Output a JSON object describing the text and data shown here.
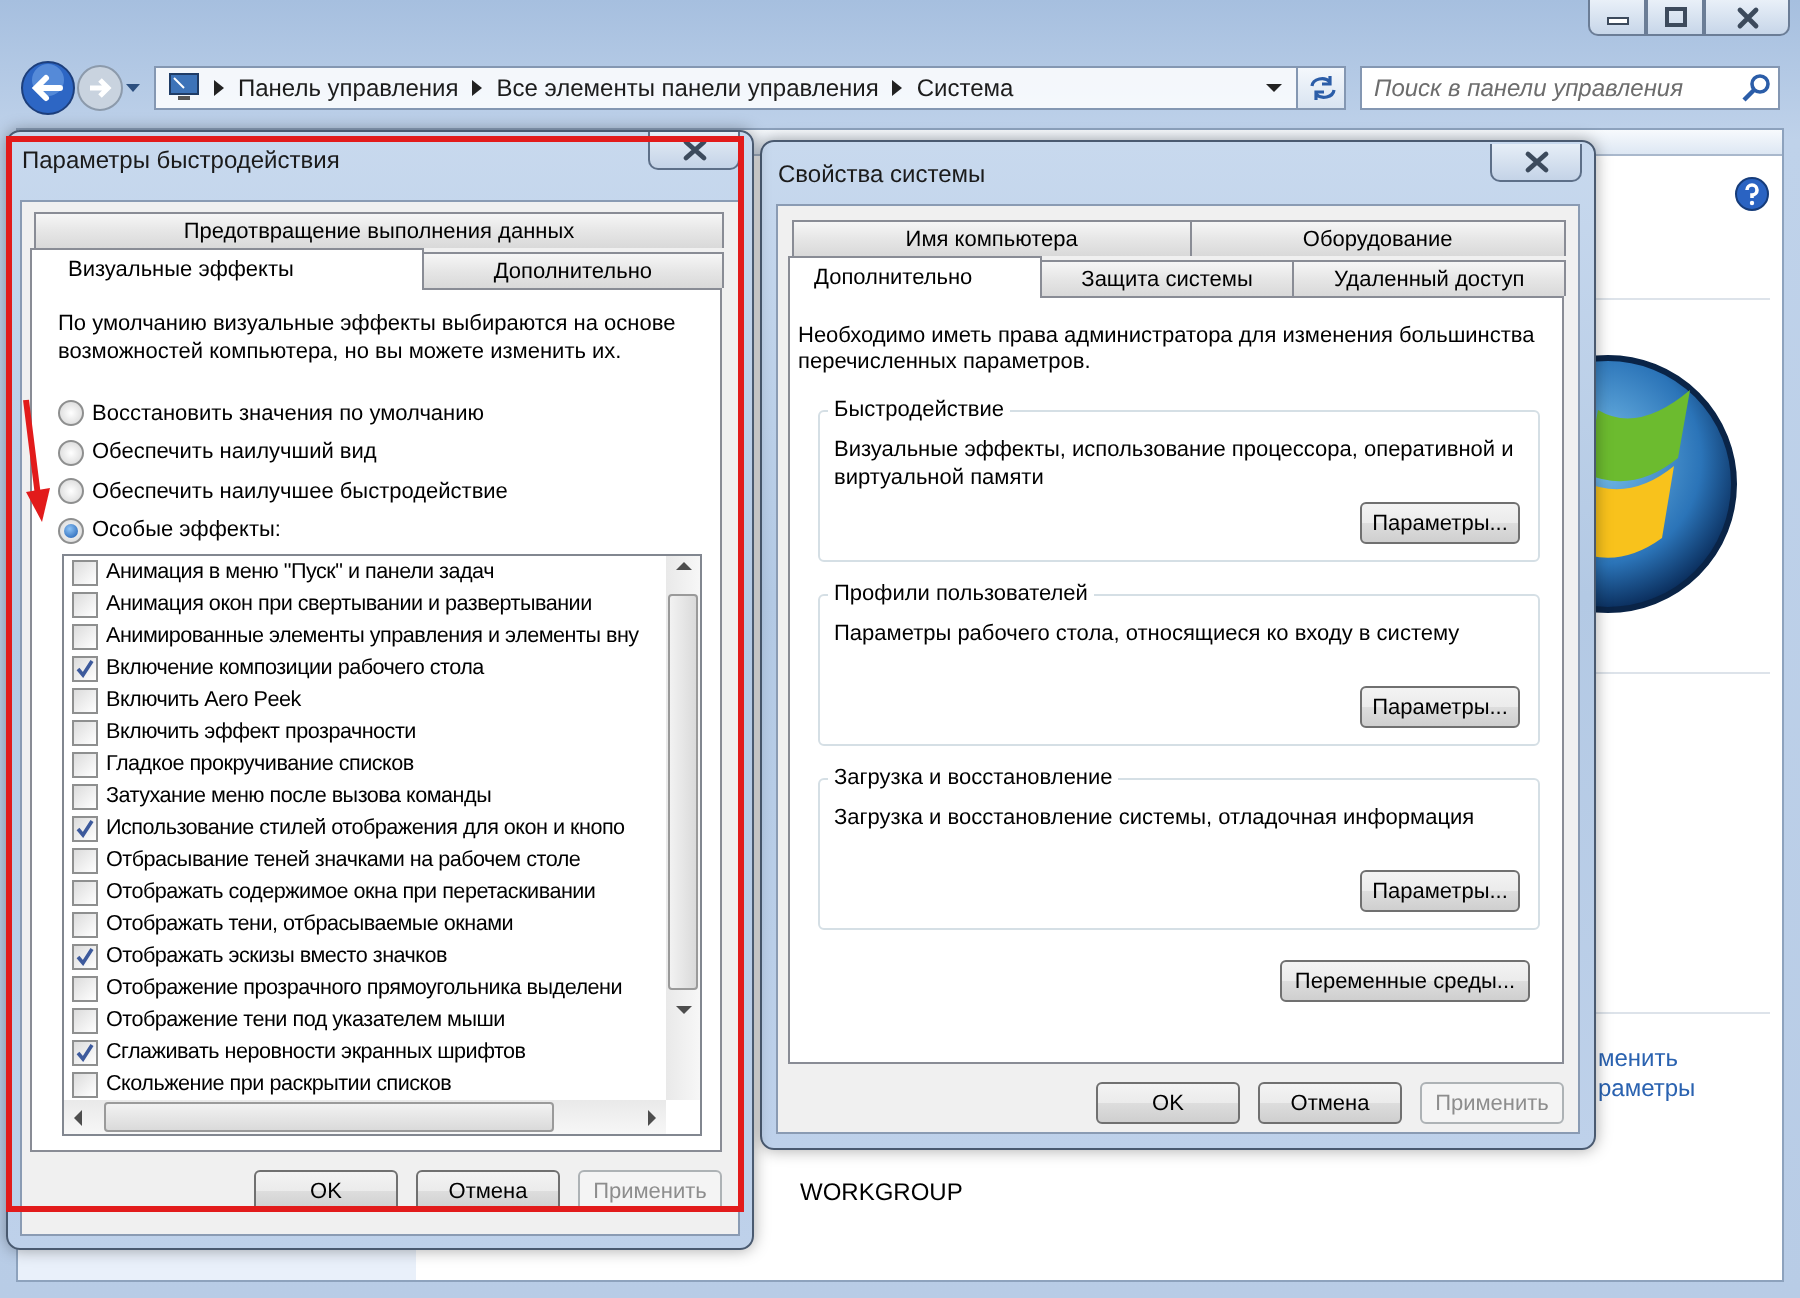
{
  "window": {
    "breadcrumb": [
      "Панель управления",
      "Все элементы панели управления",
      "Система"
    ],
    "search": {
      "placeholder": "Поиск в панели управления"
    },
    "side_links": [
      "менить",
      "раметры"
    ],
    "workgroup": "WORKGROUP"
  },
  "performance_dialog": {
    "title": "Параметры быстродействия",
    "tab_rows": [
      [
        {
          "label": "Предотвращение выполнения данных",
          "selected": false
        }
      ],
      [
        {
          "label": "Визуальные эффекты",
          "selected": true
        },
        {
          "label": "Дополнительно",
          "selected": false
        }
      ]
    ],
    "description": "По умолчанию визуальные эффекты выбираются на основе возможностей компьютера, но вы можете изменить их.",
    "options": [
      {
        "label": "Восстановить значения по умолчанию",
        "selected": false
      },
      {
        "label": "Обеспечить наилучший вид",
        "selected": false
      },
      {
        "label": "Обеспечить наилучшее быстродействие",
        "selected": false
      },
      {
        "label": "Особые эффекты:",
        "selected": true
      }
    ],
    "effects": [
      {
        "label": "Анимация в меню \"Пуск\" и панели задач",
        "checked": false
      },
      {
        "label": "Анимация окон при свертывании и развертывании",
        "checked": false
      },
      {
        "label": "Анимированные элементы управления и элементы вну",
        "checked": false
      },
      {
        "label": "Включение композиции рабочего стола",
        "checked": true
      },
      {
        "label": "Включить Aero Peek",
        "checked": false
      },
      {
        "label": "Включить эффект прозрачности",
        "checked": false
      },
      {
        "label": "Гладкое прокручивание списков",
        "checked": false
      },
      {
        "label": "Затухание меню после вызова команды",
        "checked": false
      },
      {
        "label": "Использование стилей отображения для окон и кнопо",
        "checked": true
      },
      {
        "label": "Отбрасывание теней значками на рабочем столе",
        "checked": false
      },
      {
        "label": "Отображать содержимое окна при перетаскивании",
        "checked": false
      },
      {
        "label": "Отображать тени, отбрасываемые окнами",
        "checked": false
      },
      {
        "label": "Отображать эскизы вместо значков",
        "checked": true
      },
      {
        "label": "Отображение прозрачного прямоугольника выделени",
        "checked": false
      },
      {
        "label": "Отображение тени под указателем мыши",
        "checked": false
      },
      {
        "label": "Сглаживать неровности экранных шрифтов",
        "checked": true
      },
      {
        "label": "Скольжение при раскрытии списков",
        "checked": false
      }
    ],
    "buttons": [
      {
        "label": "OK",
        "disabled": false
      },
      {
        "label": "Отмена",
        "disabled": false
      },
      {
        "label": "Применить",
        "disabled": true
      }
    ]
  },
  "system_dialog": {
    "title": "Свойства системы",
    "tab_rows": [
      [
        {
          "label": "Имя компьютера",
          "selected": false
        },
        {
          "label": "Оборудование",
          "selected": false
        }
      ],
      [
        {
          "label": "Дополнительно",
          "selected": true
        },
        {
          "label": "Защита системы",
          "selected": false
        },
        {
          "label": "Удаленный доступ",
          "selected": false
        }
      ]
    ],
    "notice": "Необходимо иметь права администратора для изменения большинства перечисленных параметров.",
    "groups": [
      {
        "title": "Быстродействие",
        "text": "Визуальные эффекты, использование процессора, оперативной и виртуальной памяти",
        "button": "Параметры..."
      },
      {
        "title": "Профили пользователей",
        "text": "Параметры рабочего стола, относящиеся ко входу в систему",
        "button": "Параметры..."
      },
      {
        "title": "Загрузка и восстановление",
        "text": "Загрузка и восстановление системы, отладочная информация",
        "button": "Параметры..."
      }
    ],
    "env_button": "Переменные среды...",
    "buttons": [
      {
        "label": "OK",
        "disabled": false
      },
      {
        "label": "Отмена",
        "disabled": false
      },
      {
        "label": "Применить",
        "disabled": true
      }
    ]
  }
}
